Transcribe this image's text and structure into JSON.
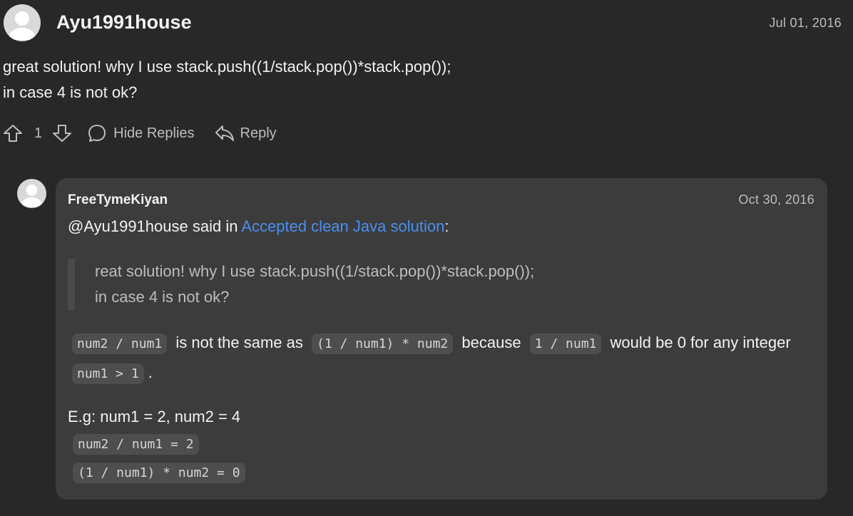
{
  "post": {
    "username": "Ayu1991house",
    "date": "Jul 01, 2016",
    "body_line1": "great solution! why I use stack.push((1/stack.pop())*stack.pop());",
    "body_line2": "in case 4 is not ok?",
    "vote_count": "1",
    "hide_replies_label": "Hide Replies",
    "reply_label": "Reply"
  },
  "reply": {
    "username": "FreeTymeKiyan",
    "date": "Oct 30, 2016",
    "mention": "@Ayu1991house",
    "said_in": " said in ",
    "link_text": "Accepted clean Java solution",
    "colon": ":",
    "quote_line1": "reat solution! why I use stack.push((1/stack.pop())*stack.pop());",
    "quote_line2": "in case 4 is not ok?",
    "code1": "num2 / num1",
    "text1": "is not the same as",
    "code2": "(1 / num1) * num2",
    "text2": "because",
    "code3": "1 / num1",
    "text3": "would be 0 for any integer",
    "code4": "num1 > 1",
    "text4": ".",
    "eg_line": "E.g: num1 = 2, num2 = 4",
    "code_line1": "num2 / num1 = 2",
    "code_line2": "(1 / num1) * num2 = 0"
  },
  "icons": {
    "upvote": "arrow-up-icon",
    "downvote": "arrow-down-icon",
    "comment": "comment-bubble-icon",
    "reply": "reply-arrow-icon",
    "avatar": "user-avatar-icon"
  },
  "colors": {
    "background": "#282828",
    "card": "#3c3c3c",
    "link": "#4a8ef0",
    "code_bg": "#4e4e4e"
  }
}
